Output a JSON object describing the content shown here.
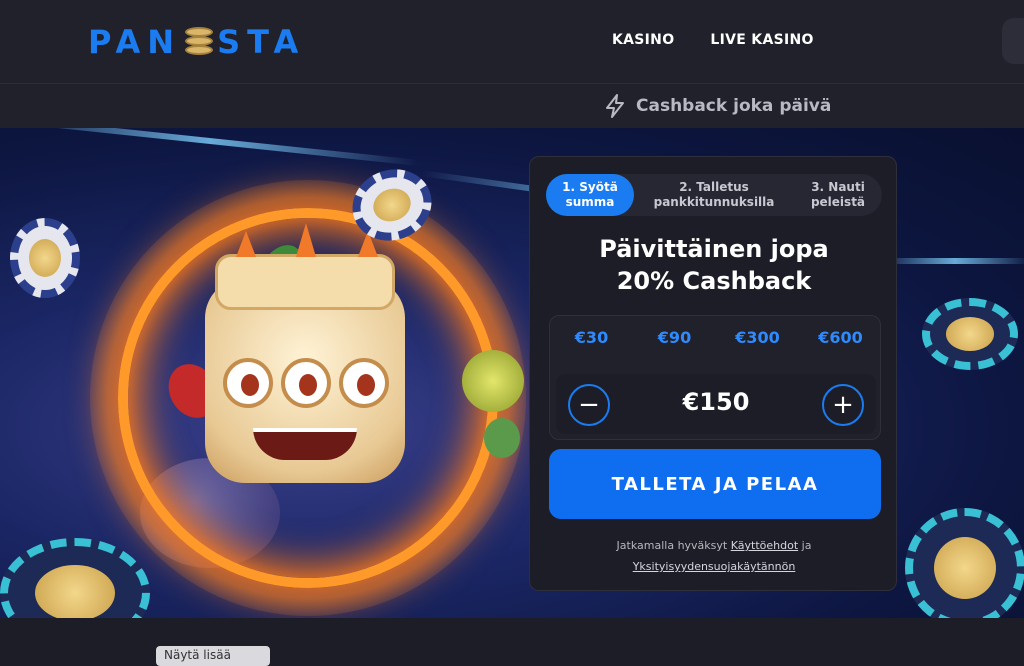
{
  "header": {
    "logo_text": "PANOSTA",
    "nav": [
      "KASINO",
      "LIVE KASINO"
    ]
  },
  "promo_bar": {
    "icon": "lightning-icon",
    "text": "Cashback joka päivä"
  },
  "deposit_card": {
    "steps": [
      {
        "label": "1. Syötä summa",
        "active": true
      },
      {
        "label": "2. Talletus pankkitunnuksilla",
        "active": false
      },
      {
        "label": "3. Nauti peleistä",
        "active": false
      }
    ],
    "title_line1": "Päivittäinen jopa",
    "title_line2": "20% Cashback",
    "presets": [
      "€30",
      "€90",
      "€300",
      "€600"
    ],
    "amount": "€150",
    "minus_label": "−",
    "plus_label": "+",
    "cta_label": "TALLETA JA PELAA",
    "terms_prefix": "Jatkamalla hyväksyt",
    "terms_link": "Käyttöehdot",
    "terms_and": "ja",
    "privacy_link": "Yksityisyydensuojakäytännön"
  },
  "bottom": {
    "button_label": "Näytä lisää"
  },
  "colors": {
    "accent": "#1a7cf0",
    "background": "#1c1d26",
    "header": "#20212b"
  }
}
